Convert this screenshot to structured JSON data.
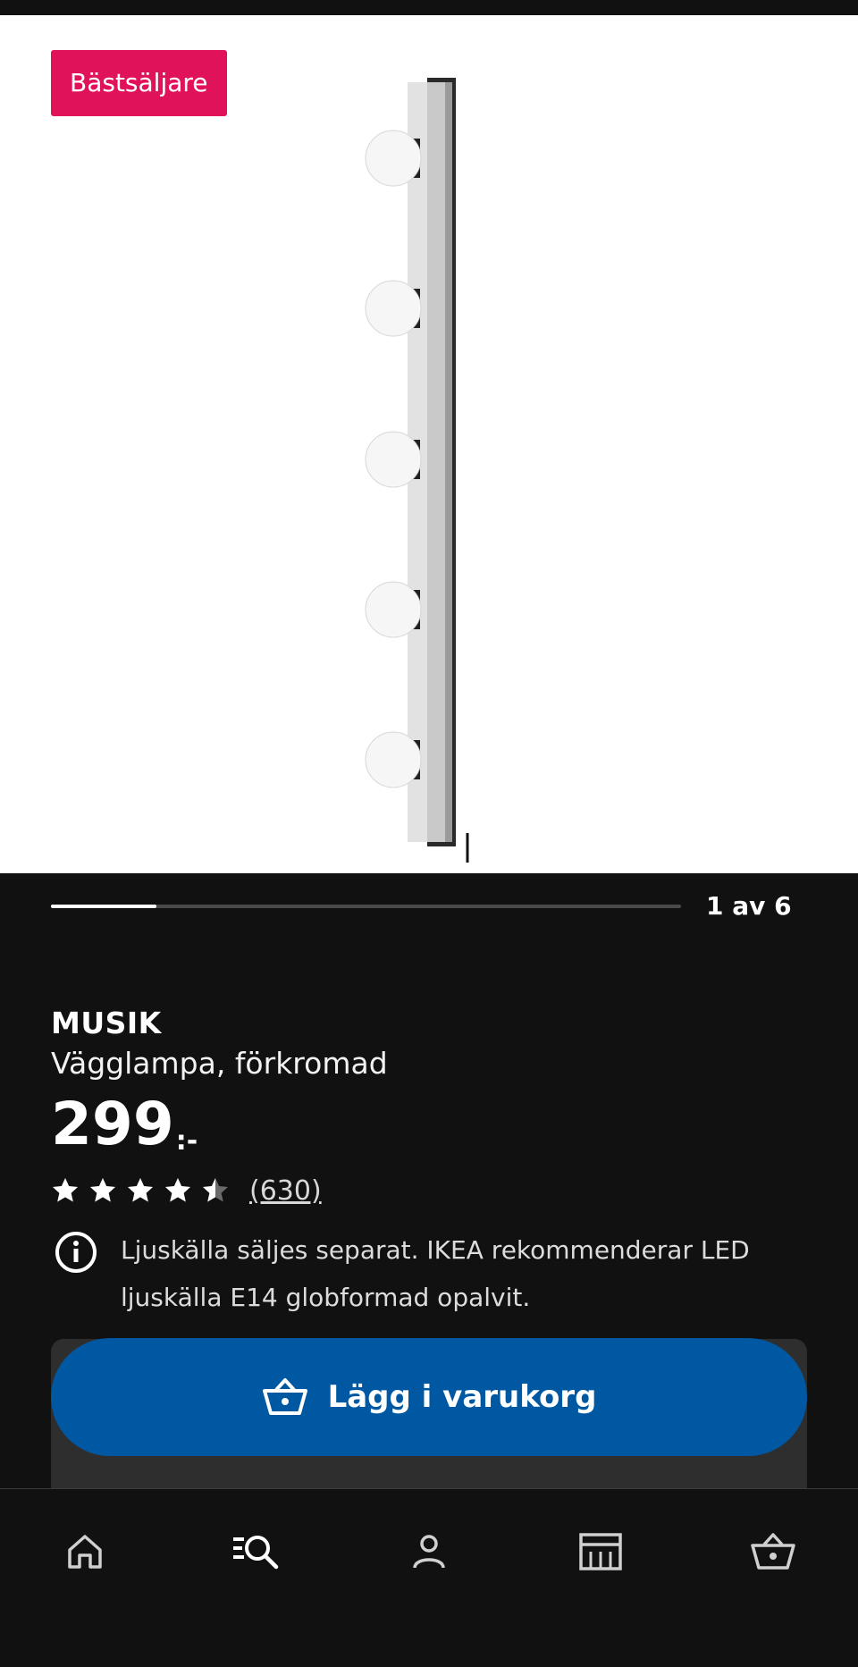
{
  "badge": "Bästsäljare",
  "gallery": {
    "counter": "1 av 6",
    "progress": 0.1667
  },
  "product": {
    "brand": "MUSIK",
    "description": "Vägglampa, förkromad",
    "price_integer": "299",
    "price_suffix": ":-",
    "rating": 4.5,
    "rating_count": "(630)",
    "info": "Ljuskälla säljes separat. IKEA rekommenderar LED ljuskälla E14 globformad opalvit."
  },
  "actions": {
    "add_to_cart": "Lägg i varukorg"
  },
  "nav": [
    "home-icon",
    "search-icon",
    "profile-icon",
    "store-icon",
    "cart-icon"
  ],
  "colors": {
    "badge": "#e0135a",
    "primary_button": "#0058a3",
    "background": "#111111"
  }
}
